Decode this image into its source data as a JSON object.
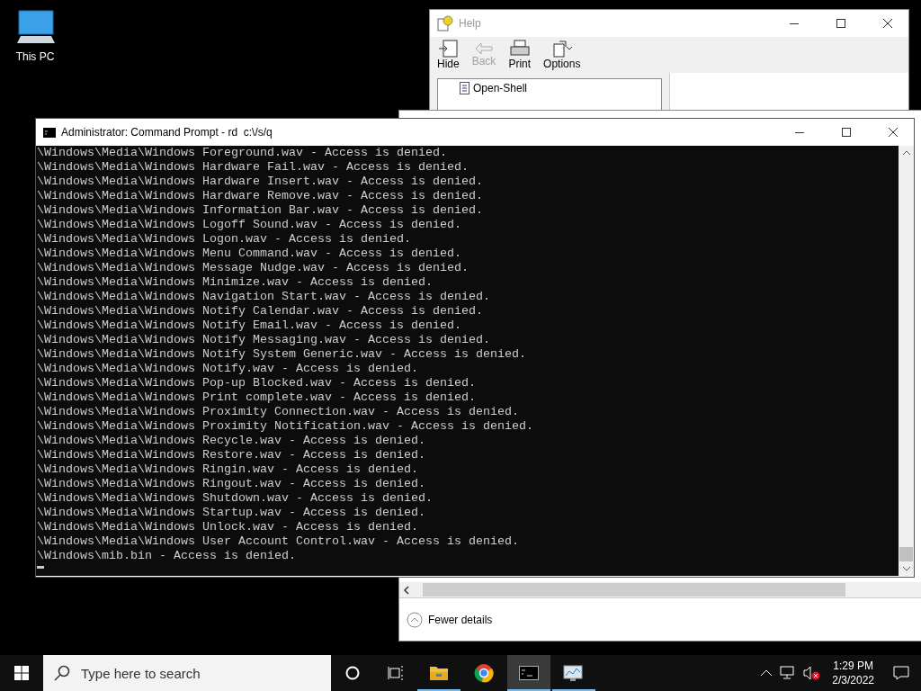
{
  "desktop_icons": [
    {
      "label": "This PC"
    }
  ],
  "help_window": {
    "title": "Help",
    "toolbar": [
      {
        "kind": "hide",
        "label": "Hide",
        "disabled": false
      },
      {
        "kind": "back",
        "label": "Back",
        "disabled": true
      },
      {
        "kind": "print",
        "label": "Print",
        "disabled": false
      },
      {
        "kind": "options",
        "label": "Options",
        "disabled": false
      }
    ],
    "tree_items": [
      "Open-Shell"
    ]
  },
  "task_manager": {
    "footer_button": "Fewer details"
  },
  "console": {
    "title": "Administrator: Command Prompt - rd  c:\\/s/q",
    "lines": [
      "\\Windows\\Media\\Windows Foreground.wav - Access is denied.",
      "\\Windows\\Media\\Windows Hardware Fail.wav - Access is denied.",
      "\\Windows\\Media\\Windows Hardware Insert.wav - Access is denied.",
      "\\Windows\\Media\\Windows Hardware Remove.wav - Access is denied.",
      "\\Windows\\Media\\Windows Information Bar.wav - Access is denied.",
      "\\Windows\\Media\\Windows Logoff Sound.wav - Access is denied.",
      "\\Windows\\Media\\Windows Logon.wav - Access is denied.",
      "\\Windows\\Media\\Windows Menu Command.wav - Access is denied.",
      "\\Windows\\Media\\Windows Message Nudge.wav - Access is denied.",
      "\\Windows\\Media\\Windows Minimize.wav - Access is denied.",
      "\\Windows\\Media\\Windows Navigation Start.wav - Access is denied.",
      "\\Windows\\Media\\Windows Notify Calendar.wav - Access is denied.",
      "\\Windows\\Media\\Windows Notify Email.wav - Access is denied.",
      "\\Windows\\Media\\Windows Notify Messaging.wav - Access is denied.",
      "\\Windows\\Media\\Windows Notify System Generic.wav - Access is denied.",
      "\\Windows\\Media\\Windows Notify.wav - Access is denied.",
      "\\Windows\\Media\\Windows Pop-up Blocked.wav - Access is denied.",
      "\\Windows\\Media\\Windows Print complete.wav - Access is denied.",
      "\\Windows\\Media\\Windows Proximity Connection.wav - Access is denied.",
      "\\Windows\\Media\\Windows Proximity Notification.wav - Access is denied.",
      "\\Windows\\Media\\Windows Recycle.wav - Access is denied.",
      "\\Windows\\Media\\Windows Restore.wav - Access is denied.",
      "\\Windows\\Media\\Windows Ringin.wav - Access is denied.",
      "\\Windows\\Media\\Windows Ringout.wav - Access is denied.",
      "\\Windows\\Media\\Windows Shutdown.wav - Access is denied.",
      "\\Windows\\Media\\Windows Startup.wav - Access is denied.",
      "\\Windows\\Media\\Windows Unlock.wav - Access is denied.",
      "\\Windows\\Media\\Windows User Account Control.wav - Access is denied.",
      "\\Windows\\mib.bin - Access is denied."
    ]
  },
  "taskbar": {
    "search": {
      "placeholder": "Type here to search"
    },
    "apps": [
      {
        "kind": "explorer",
        "running": true,
        "selected": false
      },
      {
        "kind": "browser",
        "running": false,
        "selected": false
      },
      {
        "kind": "console",
        "running": true,
        "selected": true
      },
      {
        "kind": "monitor",
        "running": true,
        "selected": false
      }
    ],
    "clock": {
      "time": "1:29 PM",
      "date": "2/3/2022"
    }
  }
}
